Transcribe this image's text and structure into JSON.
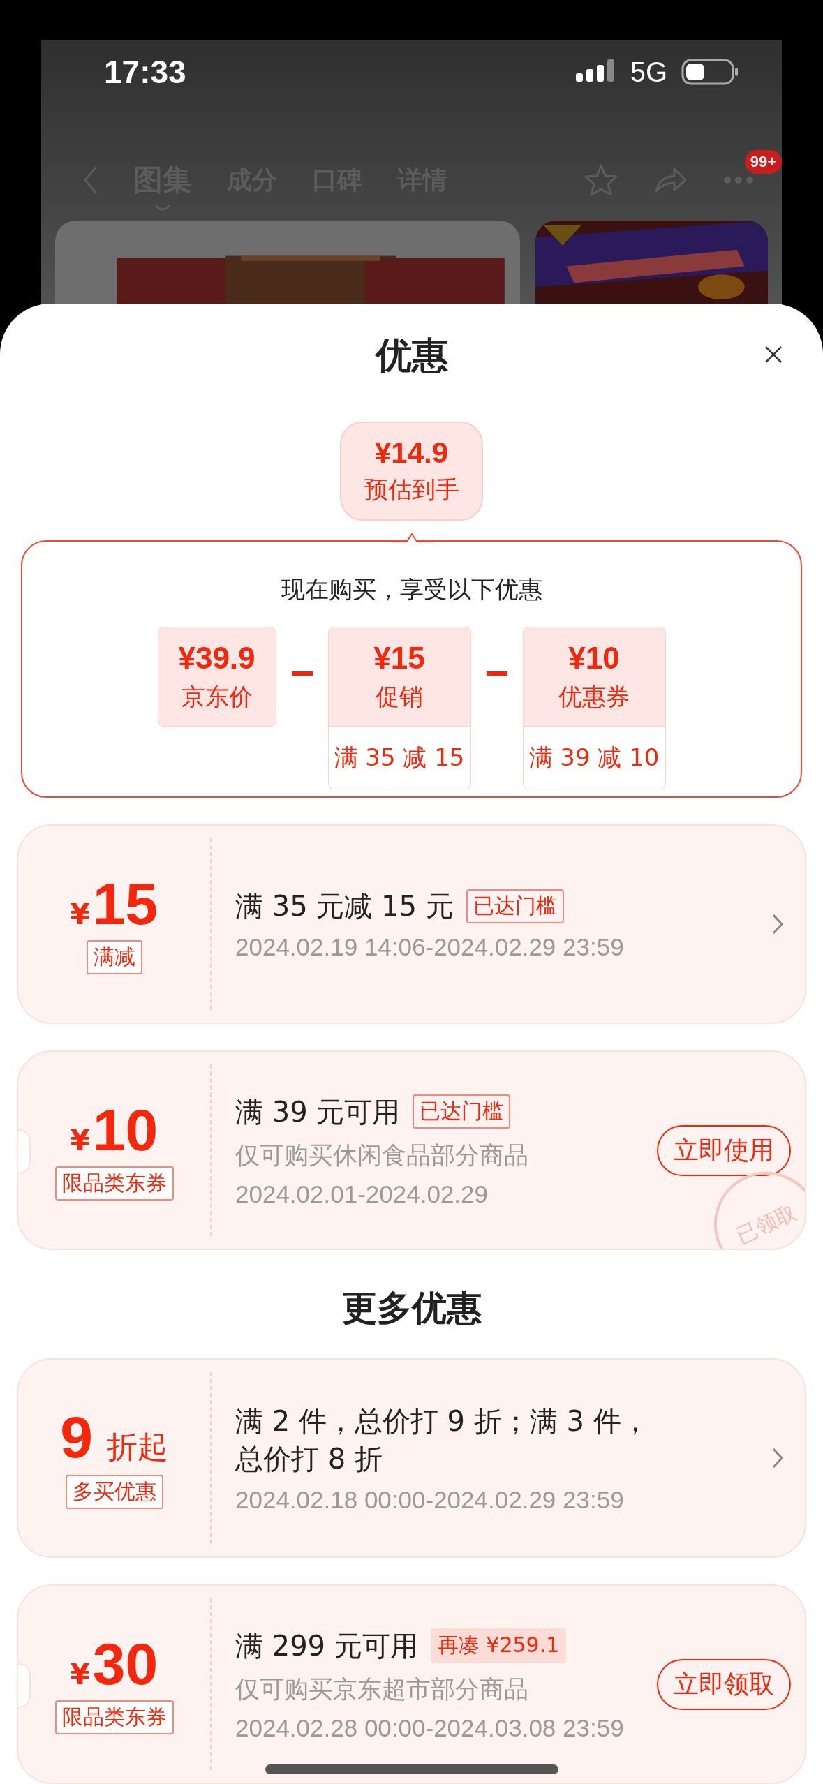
{
  "status_bar": {
    "time": "17:33",
    "network": "5G"
  },
  "nav": {
    "tabs": [
      {
        "label": "图集",
        "selected": true
      },
      {
        "label": "成分",
        "selected": false
      },
      {
        "label": "口碑",
        "selected": false
      },
      {
        "label": "详情",
        "selected": false
      }
    ],
    "badge": "99+"
  },
  "sheet": {
    "title": "优惠",
    "estimate": {
      "price": "¥14.9",
      "label": "预估到手"
    },
    "breakdown": {
      "heading": "现在购买，享受以下优惠",
      "items": [
        {
          "amount": "¥39.9",
          "label": "京东价"
        },
        {
          "amount": "¥15",
          "label": "促销",
          "condition": "满 35 减 15"
        },
        {
          "amount": "¥10",
          "label": "优惠券",
          "condition": "满 39 减 10"
        }
      ]
    },
    "coupons": [
      {
        "kind": "promo",
        "prefix": "¥",
        "amount": "15",
        "badge": "满减",
        "title": "满 35 元减 15 元",
        "tag": {
          "kind": "reached",
          "text": "已达门槛"
        },
        "lines": [
          "2024.02.19 14:06-2024.02.29 23:59"
        ],
        "action": {
          "kind": "chevron"
        }
      },
      {
        "kind": "coupon",
        "prefix": "¥",
        "amount": "10",
        "badge": "限品类东券",
        "title": "满 39 元可用",
        "tag": {
          "kind": "reached",
          "text": "已达门槛"
        },
        "lines": [
          "仅可购买休闲食品部分商品",
          "2024.02.01-2024.02.29"
        ],
        "action": {
          "kind": "button",
          "label": "立即使用"
        },
        "stamp": "已领取"
      }
    ],
    "more_heading": "更多优惠",
    "more_coupons": [
      {
        "kind": "promo",
        "amount": "9",
        "suffix": "折起",
        "badge": "多买优惠",
        "title": "满 2 件，总价打 9 折；满 3 件，总价打 8 折",
        "lines": [
          "2024.02.18 00:00-2024.02.29 23:59"
        ],
        "action": {
          "kind": "chevron"
        }
      },
      {
        "kind": "coupon",
        "prefix": "¥",
        "amount": "30",
        "badge": "限品类东券",
        "title": "满 299 元可用",
        "tag": {
          "kind": "short",
          "text": "再凑 ¥259.1"
        },
        "lines": [
          "仅可购买京东超市部分商品",
          "2024.02.28 00:00-2024.03.08 23:59"
        ],
        "action": {
          "kind": "button",
          "label": "立即领取"
        }
      }
    ]
  }
}
